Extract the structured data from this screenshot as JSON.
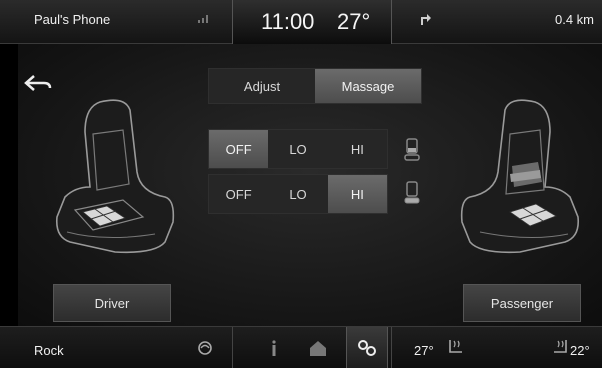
{
  "status_bar": {
    "phone_name": "Paul's Phone",
    "time": "11:00",
    "temperature": "27°",
    "distance": "0.4 km"
  },
  "tabs": [
    {
      "label": "Adjust",
      "active": false
    },
    {
      "label": "Massage",
      "active": true
    }
  ],
  "massage_rows": [
    {
      "options": [
        {
          "label": "OFF",
          "active": true
        },
        {
          "label": "LO",
          "active": false
        },
        {
          "label": "HI",
          "active": false
        }
      ],
      "icon": "seat-back-icon"
    },
    {
      "options": [
        {
          "label": "OFF",
          "active": false
        },
        {
          "label": "LO",
          "active": false
        },
        {
          "label": "HI",
          "active": true
        }
      ],
      "icon": "seat-cushion-icon"
    }
  ],
  "seats": {
    "driver_button": "Driver",
    "passenger_button": "Passenger"
  },
  "bottom_bar": {
    "source": "Rock",
    "driver_temp": "27°",
    "passenger_temp": "22°"
  },
  "colors": {
    "background": "#000000",
    "active_segment": "#5c5c5c",
    "text": "#e6e6e6"
  }
}
